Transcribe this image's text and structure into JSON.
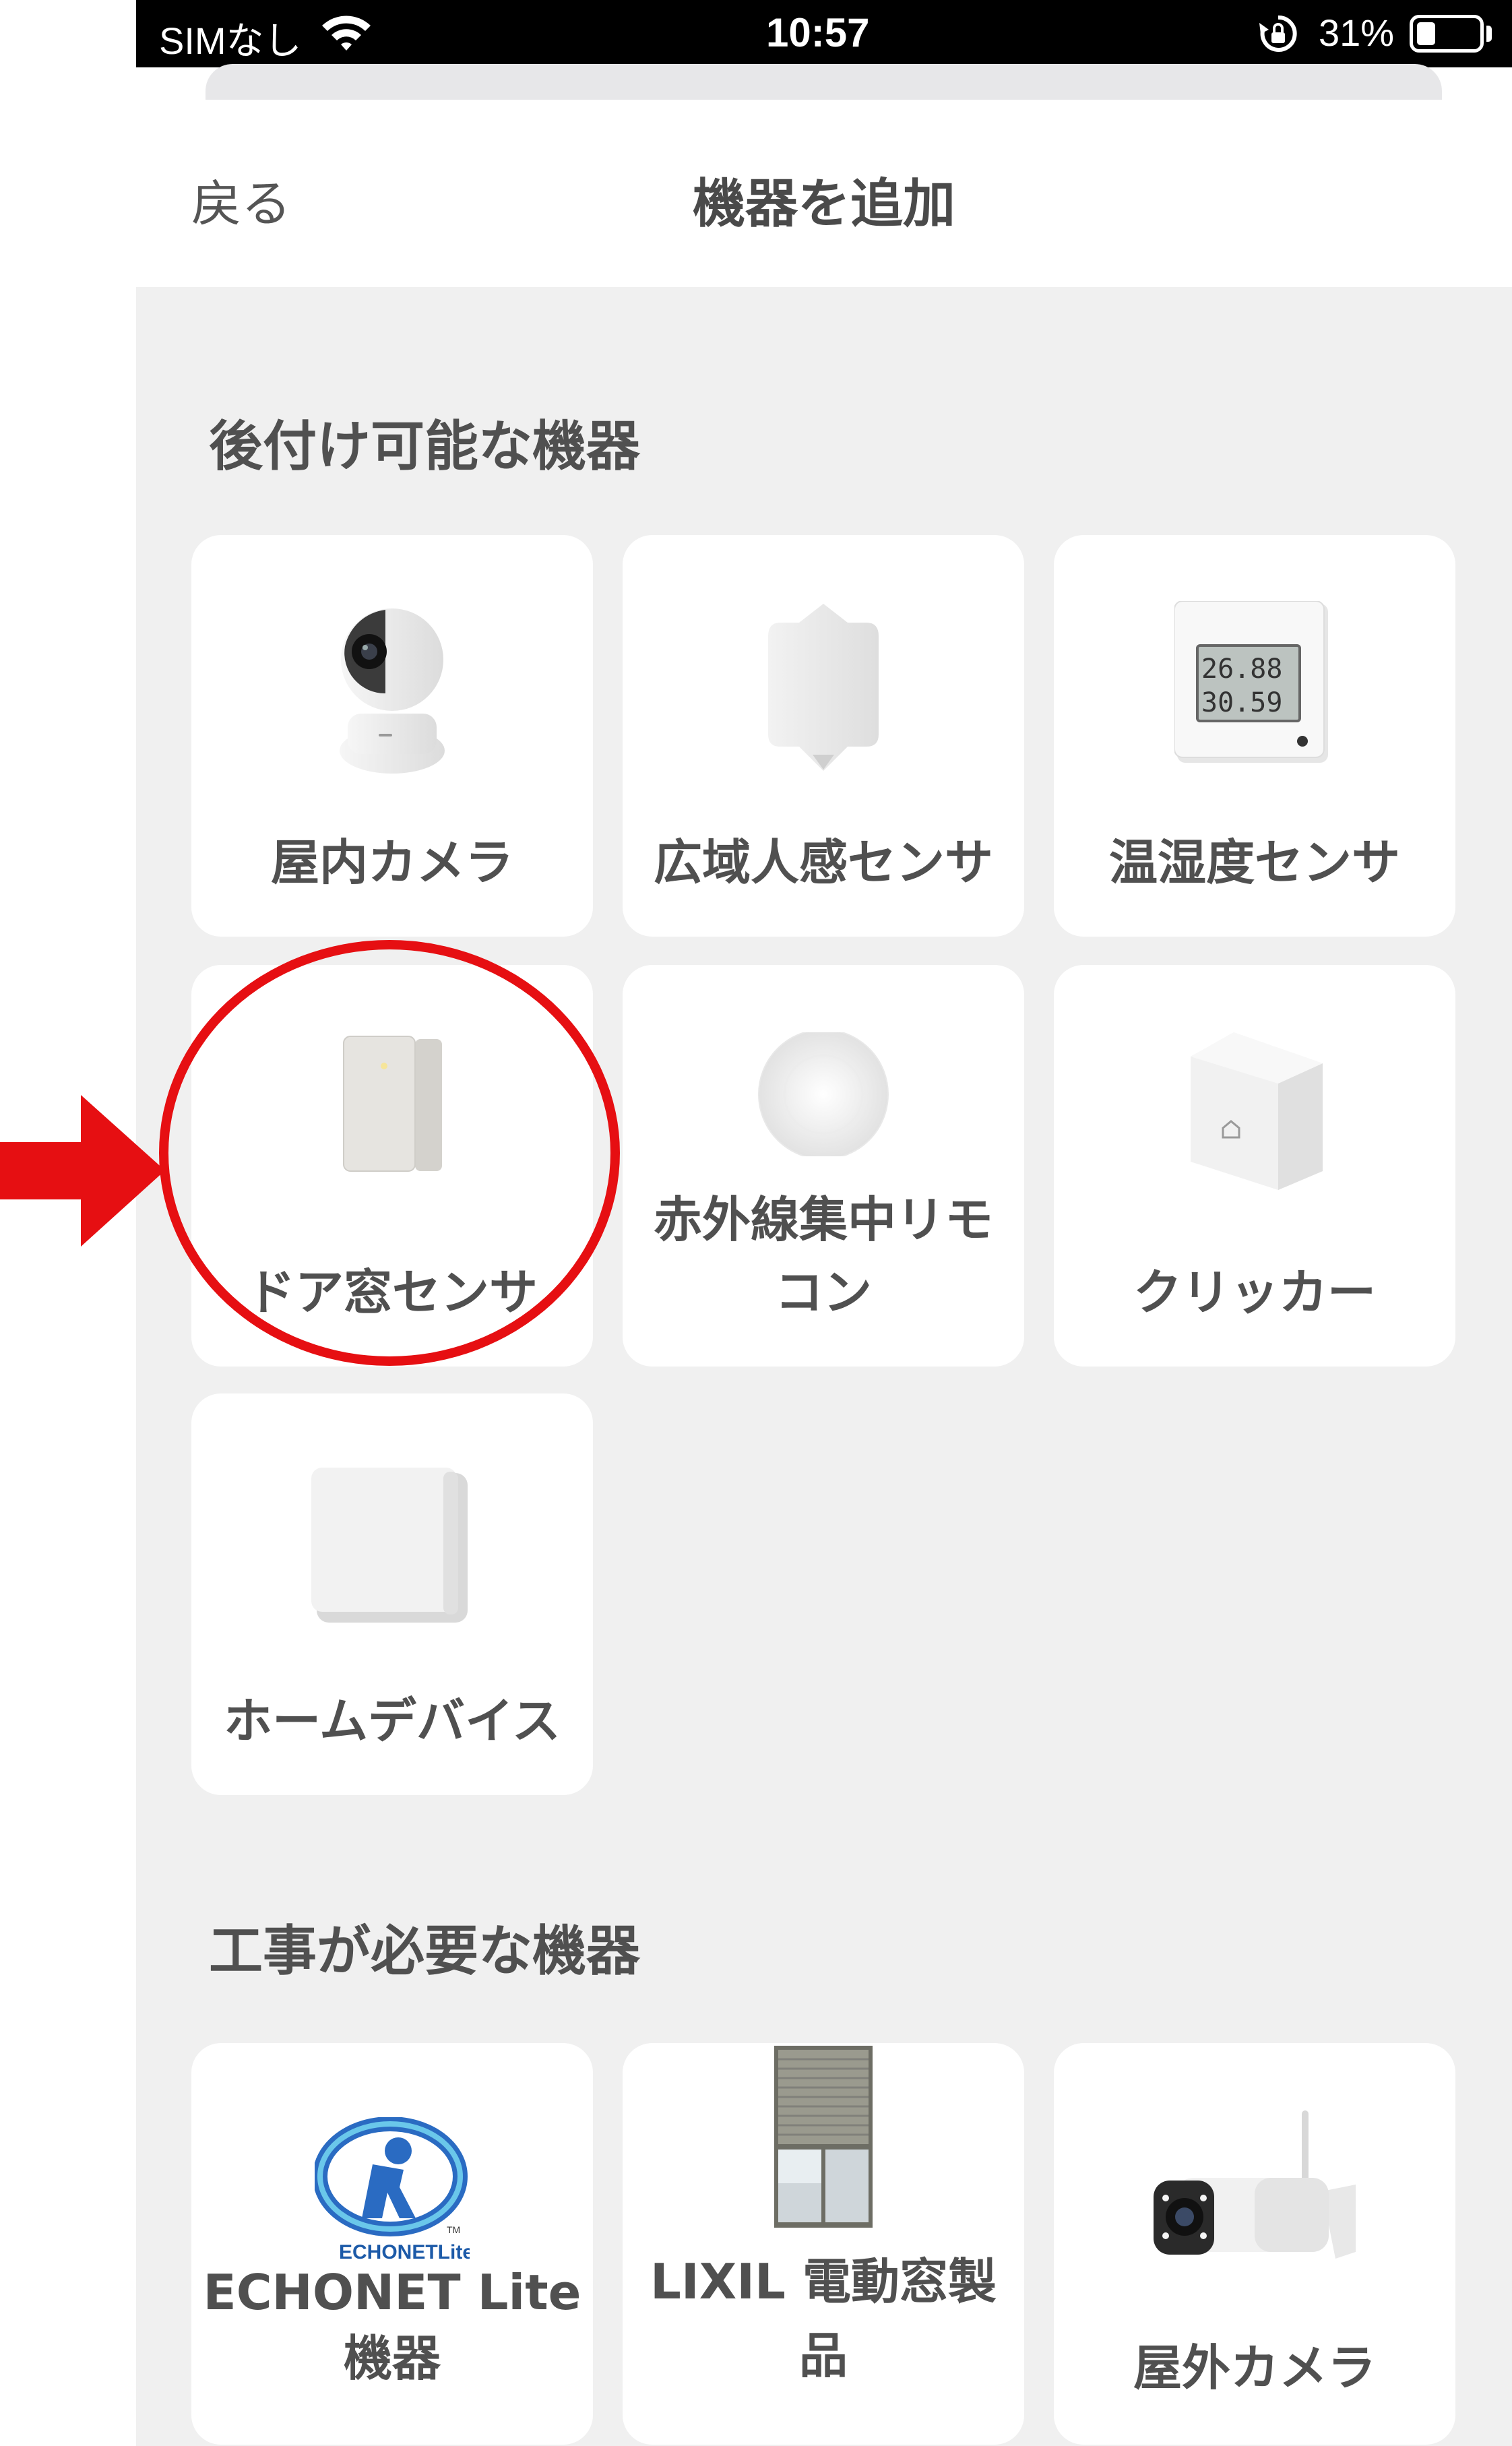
{
  "status_bar": {
    "carrier": "SIMなし",
    "time": "10:57",
    "battery_percent": "31%",
    "battery_level": 0.31
  },
  "header": {
    "back_label": "戻る",
    "title": "機器を追加"
  },
  "sections": [
    {
      "title": "後付け可能な機器",
      "items": [
        {
          "label": "屋内カメラ",
          "icon": "indoor-camera-icon"
        },
        {
          "label": "広域人感センサ",
          "icon": "motion-sensor-icon"
        },
        {
          "label": "温湿度センサ",
          "icon": "thermo-hygrometer-icon",
          "display_temp": "26.88",
          "display_humidity": "30.59"
        },
        {
          "label": "ドア窓センサ",
          "icon": "door-window-sensor-icon"
        },
        {
          "label_line1": "赤外線集中リモ",
          "label_line2": "コン",
          "icon": "ir-remote-icon"
        },
        {
          "label": "クリッカー",
          "icon": "clicker-icon"
        },
        {
          "label": "ホームデバイス",
          "icon": "home-device-icon"
        }
      ]
    },
    {
      "title": "工事が必要な機器",
      "items": [
        {
          "label_line1": "ECHONET Lite",
          "label_line2": "機器",
          "icon": "echonet-lite-logo",
          "logo_text": "ECHONETLite",
          "logo_tm": "TM"
        },
        {
          "label_line1": "LIXIL 電動窓製",
          "label_line2": "品",
          "icon": "lixil-shutter-icon"
        },
        {
          "label": "屋外カメラ",
          "icon": "outdoor-camera-icon"
        }
      ]
    }
  ],
  "annotation": {
    "color": "#e60f12",
    "highlighted_item": "ドア窓センサ"
  },
  "colors": {
    "background": "#f0f0f0",
    "card": "#ffffff",
    "text": "#505050",
    "status_bar": "#000000"
  }
}
